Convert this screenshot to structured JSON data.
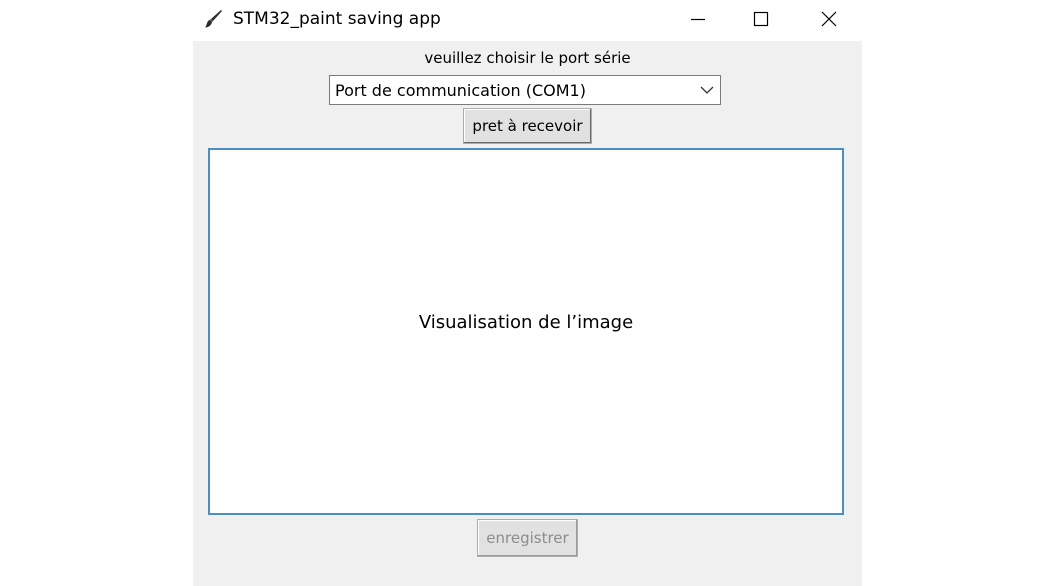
{
  "window": {
    "title": "STM32_paint saving app",
    "icon": "paintbrush-icon",
    "controls": [
      "minimize-icon",
      "maximize-icon",
      "close-icon"
    ]
  },
  "port": {
    "label": "veuillez choisir le port série",
    "selected": "Port de communication (COM1)"
  },
  "buttons": {
    "receive_label": "pret à recevoir",
    "save_label": "enregistrer"
  },
  "canvas": {
    "placeholder": "Visualisation de l’image"
  },
  "colors": {
    "window_bg": "#f0f0f0",
    "canvas_border": "#4a8fc4",
    "disabled_text": "#8d8d8d"
  }
}
